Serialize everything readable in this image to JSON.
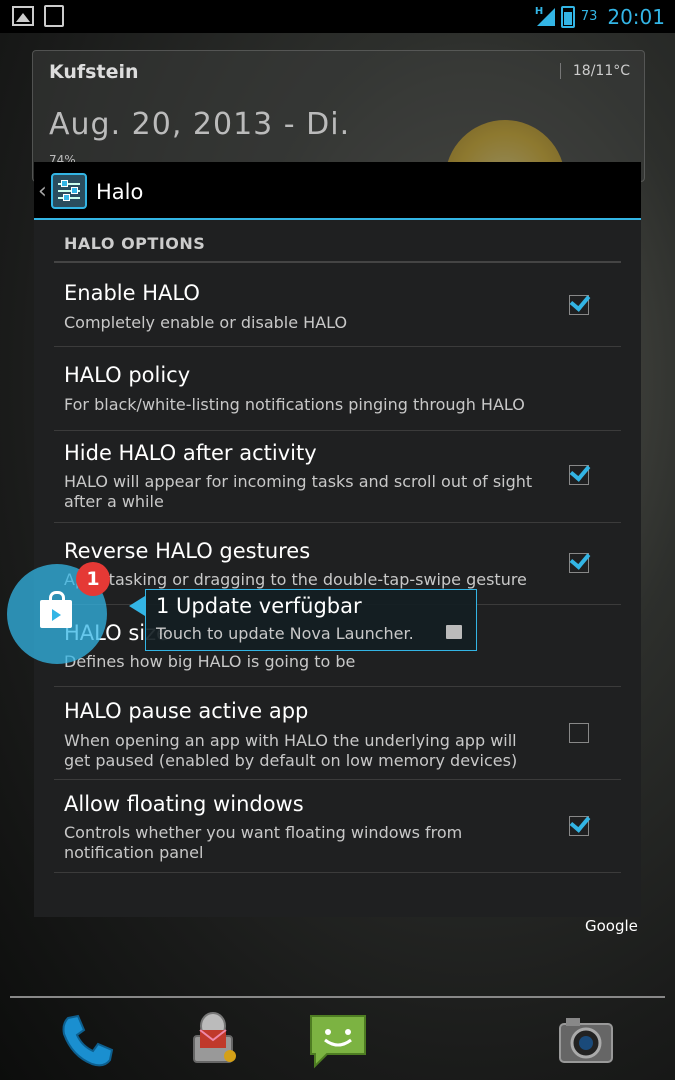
{
  "status_bar": {
    "left_icons": [
      "gallery-icon",
      "store-bag-icon"
    ],
    "network": "H",
    "battery_percent": "73",
    "time": "20:01",
    "accent_color": "#33b5e5"
  },
  "widget": {
    "city": "Kufstein",
    "temperature": "18/11°C",
    "date": "Aug. 20, 2013 - Di.",
    "battery": "74%"
  },
  "dialog": {
    "title": "Halo",
    "section": "HALO OPTIONS",
    "items": [
      {
        "title": "Enable HALO",
        "summary": "Completely enable or disable HALO",
        "checked": true
      },
      {
        "title": "HALO policy",
        "summary": "For black/white-listing notifications pinging through HALO",
        "checked": null
      },
      {
        "title": "Hide HALO after activity",
        "summary": "HALO will appear for incoming tasks and scroll out of sight after a while",
        "checked": true
      },
      {
        "title": "Reverse HALO gestures",
        "summary": "Apps tasking or dragging to the double-tap-swipe gesture",
        "checked": true
      },
      {
        "title": "HALO size",
        "summary": "Defines how big HALO is going to be",
        "checked": null
      },
      {
        "title": "HALO pause active app",
        "summary": "When opening an app with HALO the underlying app will get paused (enabled by default on low memory devices)",
        "checked": false
      },
      {
        "title": "Allow floating windows",
        "summary": "Controls whether you want floating windows from notification panel",
        "checked": true
      }
    ]
  },
  "halo_notification": {
    "badge_count": "1",
    "title": "1 Update verfügbar",
    "text": "Touch to update Nova Launcher."
  },
  "search_widget": {
    "label": "Google"
  },
  "dock": [
    "phone-icon",
    "email-icon",
    "messaging-icon",
    "camera-icon"
  ]
}
